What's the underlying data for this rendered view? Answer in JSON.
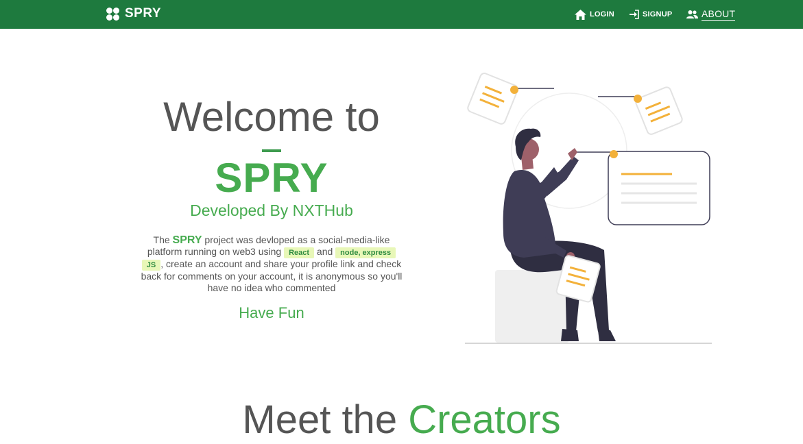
{
  "navbar": {
    "brand": "SPRY",
    "brand_icon": "flower-clover-icon",
    "background": "#1e7a3e",
    "items": [
      {
        "label": "LOGIN",
        "icon": "home-icon"
      },
      {
        "label": "SIGNUP",
        "icon": "sign-in-icon"
      },
      {
        "label": "ABOUT",
        "icon": "users-icon",
        "active": true
      }
    ]
  },
  "hero": {
    "welcome": "Welcome to",
    "title": "SPRY",
    "subtitle": "Developed By NXTHub",
    "description": {
      "part1": "The ",
      "brand": "SPRY",
      "part2": " project was devloped as a social-media-like platform running on web3 using ",
      "tag_react": "React",
      "part3": " and ",
      "tag_node": "node, express",
      "tag_js": "JS",
      "part4": ", create an account and share your profile link and check back for comments on your account, it is anonymous so you'll have no idea who commented"
    },
    "closing": "Have Fun",
    "accent_color": "#46ab4f"
  },
  "creators": {
    "heading_part1": "Meet the ",
    "heading_part2": "Creators"
  }
}
